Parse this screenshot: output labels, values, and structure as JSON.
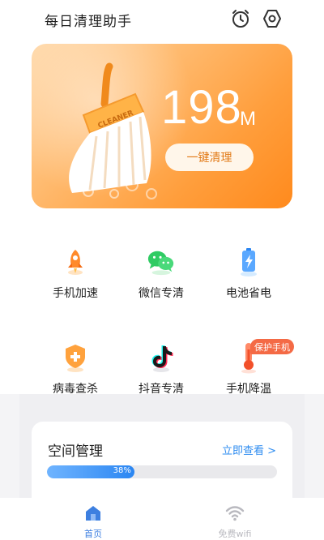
{
  "app": {
    "title": "每日清理助手"
  },
  "header": {
    "alarm_icon": "alarm-clock-icon",
    "settings_icon": "hexagon-settings-icon"
  },
  "hero": {
    "junk_size": "198",
    "junk_unit": "M",
    "broom_label": "CLEANER",
    "clean_button": "一键清理",
    "gradient_colors": [
      "#ffd8a8",
      "#ff8a1d"
    ]
  },
  "tools": [
    {
      "label": "手机加速",
      "icon": "rocket-icon"
    },
    {
      "label": "微信专清",
      "icon": "wechat-icon"
    },
    {
      "label": "电池省电",
      "icon": "battery-icon"
    },
    {
      "label": "病毒查杀",
      "icon": "shield-icon"
    },
    {
      "label": "抖音专清",
      "icon": "tiktok-icon"
    },
    {
      "label": "手机降温",
      "icon": "thermometer-icon"
    }
  ],
  "cooling_badge": "保护手机",
  "space": {
    "title": "空间管理",
    "link": "立即查看 >",
    "used_percent": 38,
    "used_label": "38%"
  },
  "bottom_nav": [
    {
      "label": "首页",
      "icon": "home-icon",
      "active": true,
      "color": "#3d7fe0"
    },
    {
      "label": "免费wifi",
      "icon": "wifi-icon",
      "active": false,
      "color": "#b9b9bf"
    }
  ]
}
